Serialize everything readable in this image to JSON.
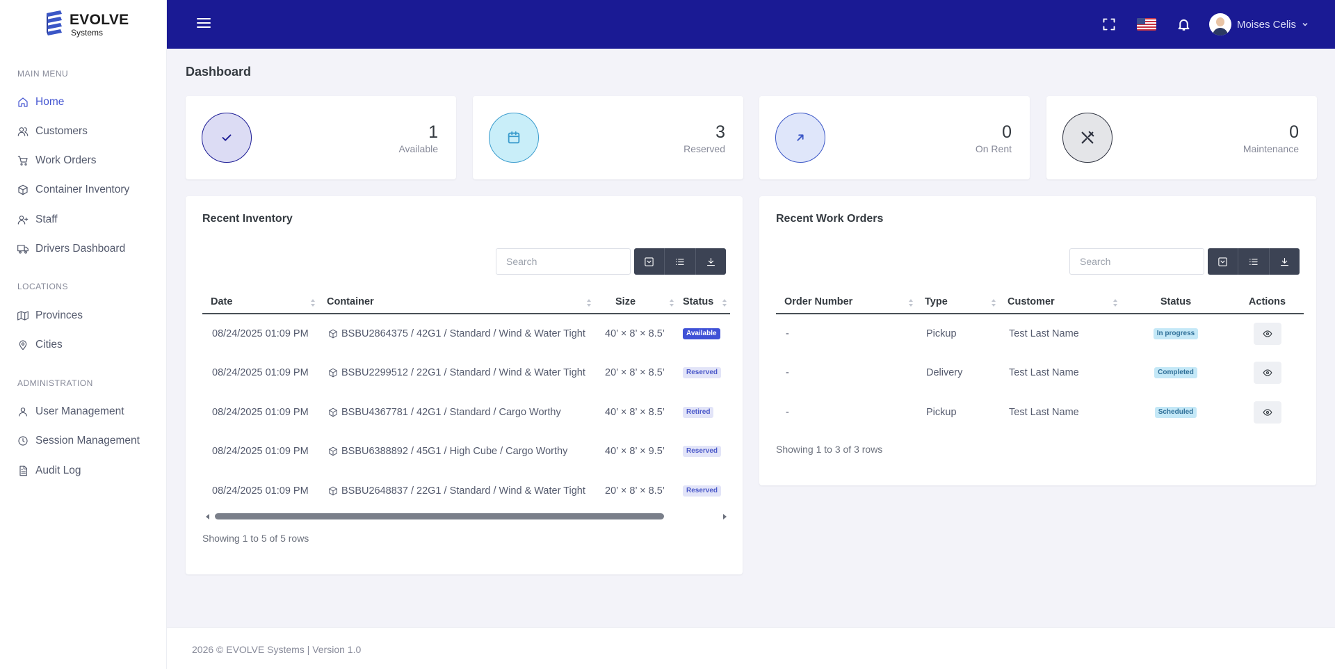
{
  "brand": {
    "name": "EVOLVE",
    "sub": "Systems"
  },
  "sidebar": {
    "sections": [
      {
        "title": "MAIN MENU"
      },
      {
        "title": "LOCATIONS"
      },
      {
        "title": "ADMINISTRATION"
      }
    ],
    "items": [
      {
        "label": "Home",
        "icon": "home-icon"
      },
      {
        "label": "Customers",
        "icon": "users-icon"
      },
      {
        "label": "Work Orders",
        "icon": "cart-icon"
      },
      {
        "label": "Container Inventory",
        "icon": "box-icon"
      },
      {
        "label": "Staff",
        "icon": "user-plus-icon"
      },
      {
        "label": "Drivers Dashboard",
        "icon": "truck-icon"
      },
      {
        "label": "Provinces",
        "icon": "map-icon"
      },
      {
        "label": "Cities",
        "icon": "map-pin-icon"
      },
      {
        "label": "User Management",
        "icon": "user-icon"
      },
      {
        "label": "Session Management",
        "icon": "clock-icon"
      },
      {
        "label": "Audit Log",
        "icon": "file-text-icon"
      }
    ]
  },
  "topbar": {
    "user_name": "Moises Celis"
  },
  "page": {
    "title": "Dashboard"
  },
  "stats": [
    {
      "value": "1",
      "label": "Available",
      "icon": "check-icon",
      "color": "#1a1a94",
      "bg": "#dcdcf4"
    },
    {
      "value": "3",
      "label": "Reserved",
      "icon": "calendar-icon",
      "color": "#3b9ccd",
      "bg": "#c9eef9"
    },
    {
      "value": "0",
      "label": "On Rent",
      "icon": "arrow-up-right-icon",
      "color": "#3a56c6",
      "bg": "#dfe6fa"
    },
    {
      "value": "0",
      "label": "Maintenance",
      "icon": "tools-icon",
      "color": "#2f3340",
      "bg": "#e4e5e8"
    }
  ],
  "inventory": {
    "title": "Recent Inventory",
    "search_placeholder": "Search",
    "columns": [
      "Date",
      "Container",
      "Size",
      "Status"
    ],
    "rows": [
      {
        "date": "08/24/2025 01:09 PM",
        "container": "BSBU2864375 / 42G1 / Standard / Wind & Water Tight",
        "size": "40’ × 8’ × 8.5’",
        "status": "Available",
        "status_class": "b-available"
      },
      {
        "date": "08/24/2025 01:09 PM",
        "container": "BSBU2299512 / 22G1 / Standard / Wind & Water Tight",
        "size": "20’ × 8’ × 8.5’",
        "status": "Reserved",
        "status_class": "b-reserved"
      },
      {
        "date": "08/24/2025 01:09 PM",
        "container": "BSBU4367781 / 42G1 / Standard / Cargo Worthy",
        "size": "40’ × 8’ × 8.5’",
        "status": "Retired",
        "status_class": "b-retired"
      },
      {
        "date": "08/24/2025 01:09 PM",
        "container": "BSBU6388892 / 45G1 / High Cube / Cargo Worthy",
        "size": "40’ × 8’ × 9.5’",
        "status": "Reserved",
        "status_class": "b-reserved"
      },
      {
        "date": "08/24/2025 01:09 PM",
        "container": "BSBU2648837 / 22G1 / Standard / Wind & Water Tight",
        "size": "20’ × 8’ × 8.5’",
        "status": "Reserved",
        "status_class": "b-reserved"
      }
    ],
    "showing": "Showing 1 to 5 of 5 rows"
  },
  "work_orders": {
    "title": "Recent Work Orders",
    "search_placeholder": "Search",
    "columns": [
      "Order Number",
      "Type",
      "Customer",
      "Status",
      "Actions"
    ],
    "rows": [
      {
        "order": "-",
        "type": "Pickup",
        "customer": "Test Last Name",
        "status": "In progress",
        "status_class": "b-progress"
      },
      {
        "order": "-",
        "type": "Delivery",
        "customer": "Test Last Name",
        "status": "Completed",
        "status_class": "b-completed"
      },
      {
        "order": "-",
        "type": "Pickup",
        "customer": "Test Last Name",
        "status": "Scheduled",
        "status_class": "b-scheduled"
      }
    ],
    "showing": "Showing 1 to 3 of 3 rows"
  },
  "footer": {
    "text": "2026 © EVOLVE Systems | Version 1.0"
  }
}
